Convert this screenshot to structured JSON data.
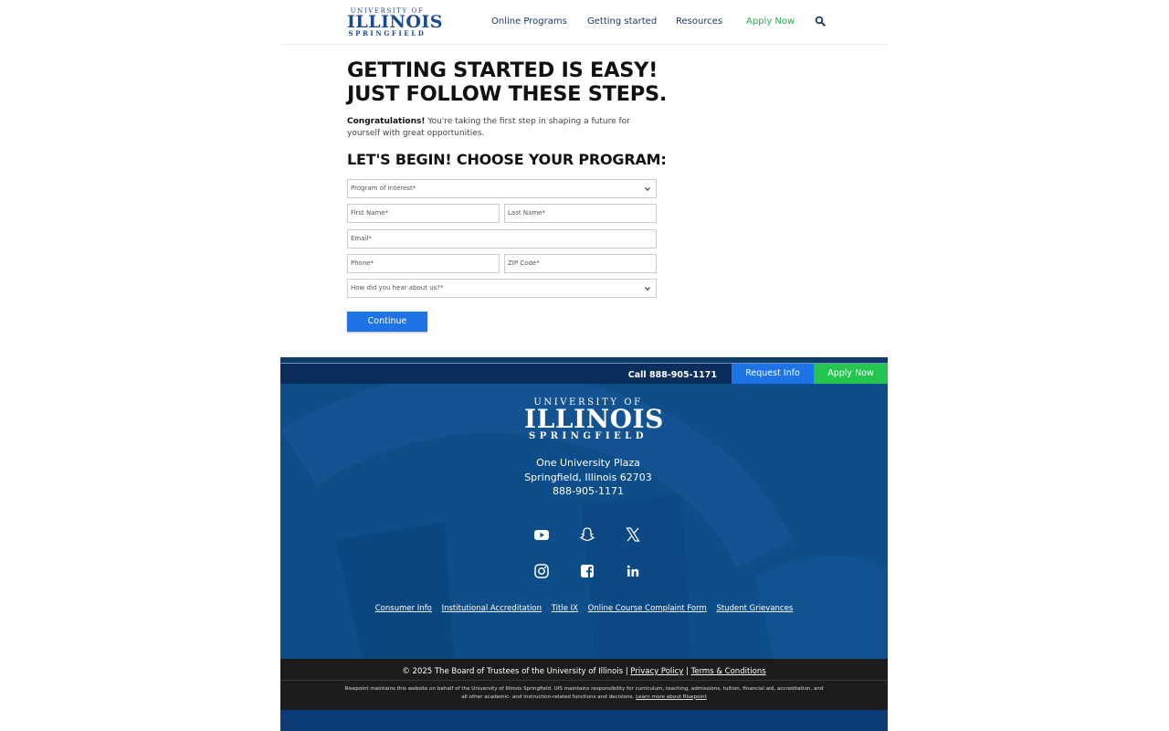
{
  "header": {
    "logo": {
      "line1": "UNIVERSITY OF",
      "line2": "ILLINOIS",
      "line3": "SPRINGFIELD"
    },
    "nav": [
      {
        "label": "Online Programs"
      },
      {
        "label": "Getting started"
      },
      {
        "label": "Resources"
      },
      {
        "label": "Apply Now"
      }
    ],
    "search_icon": "search-icon"
  },
  "main": {
    "heading_line1": "GETTING STARTED IS EASY!",
    "heading_line2": "JUST FOLLOW THESE STEPS.",
    "intro_bold": "Congratulations!",
    "intro_text": " You're taking the first step in shaping a future for yourself with great opportunities.",
    "subheading": "LET'S BEGIN! CHOOSE YOUR PROGRAM:",
    "form": {
      "program_placeholder": "Program of Interest*",
      "first_name_placeholder": "First Name*",
      "last_name_placeholder": "Last Name*",
      "email_placeholder": "Email*",
      "phone_placeholder": "Phone*",
      "zip_placeholder": "ZIP Code*",
      "source_placeholder": "How did you hear about us?*",
      "submit_label": "Continue"
    }
  },
  "footer": {
    "call_label": "Call 888-905-1171",
    "request_info_label": "Request Info",
    "apply_now_label": "Apply Now",
    "logo": {
      "line1": "UNIVERSITY OF",
      "line2": "ILLINOIS",
      "line3": "SPRINGFIELD"
    },
    "address": [
      "One University Plaza",
      "Springfield, Illinois 62703",
      "888-905-1171"
    ],
    "social_icons": [
      "youtube-icon",
      "snapchat-icon",
      "x-icon",
      "instagram-icon",
      "facebook-icon",
      "linkedin-icon"
    ],
    "links": [
      "Consumer Info",
      "Institutional Accreditation",
      "Title IX",
      "Online Course Complaint Form",
      "Student Grievances"
    ],
    "copyright": "© 2025 The Board of Trustees of the University of Illinois |",
    "privacy_label": "Privacy Policy",
    "divider": "|",
    "terms_label": "Terms & Conditions",
    "disclaimer": "Risepoint maintains this website on behalf of the University of Illinois Springfield. UIS maintains responsibility for curriculum, teaching, admissions, tuition, financial aid, accreditation, and all other academic- and instruction-related functions and decisions.",
    "learn_more_label": "Learn more about Risepoint"
  },
  "colors": {
    "brand_blue": "#1a4a8c",
    "accent_blue": "#1e74e6",
    "accent_green": "#22b14c",
    "footer_blue": "#0d4d8a"
  }
}
